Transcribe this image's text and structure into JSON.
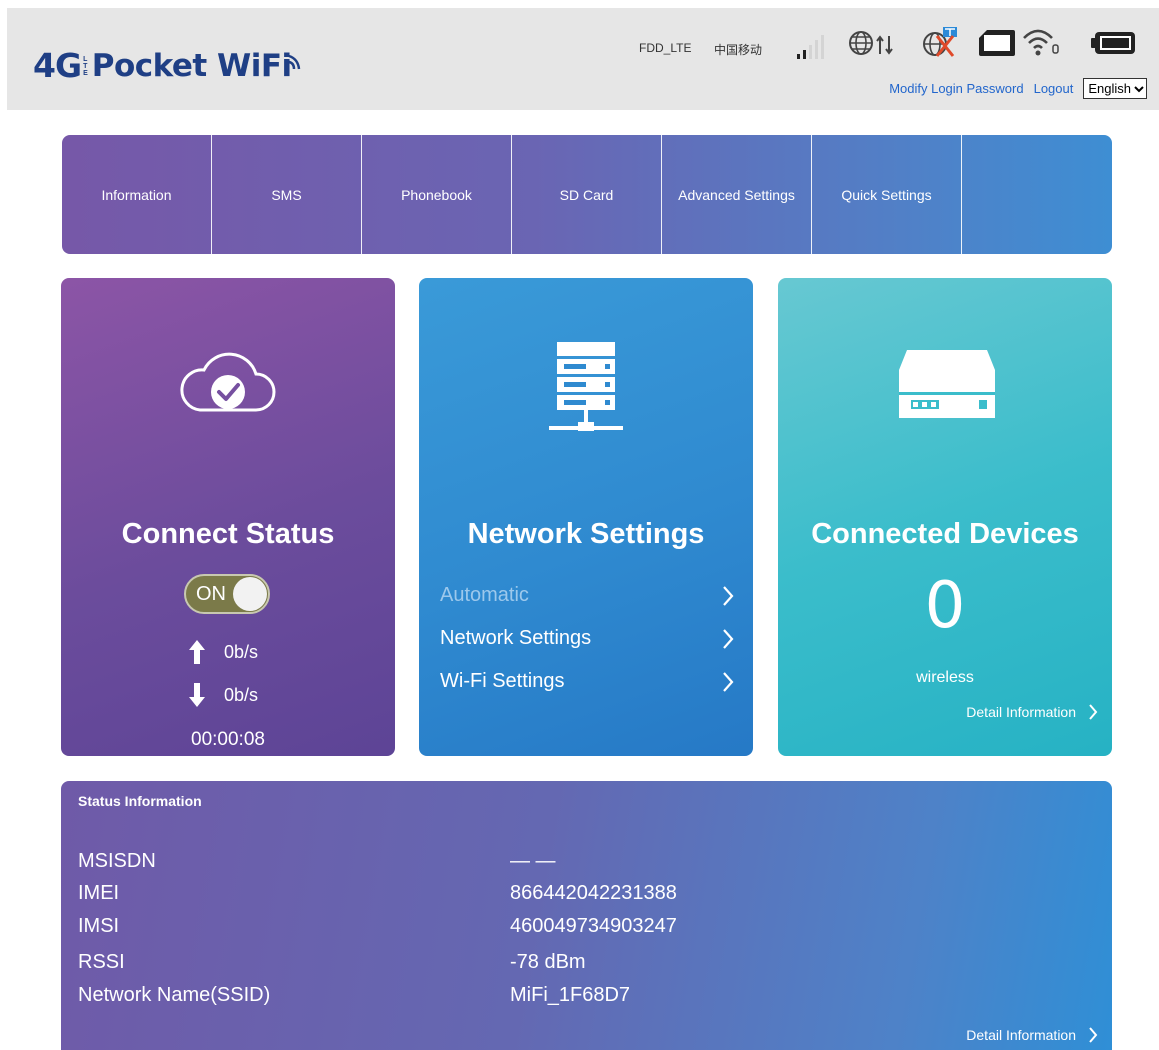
{
  "header": {
    "logo_4g": "4G",
    "logo_lte": [
      "L",
      "T",
      "E"
    ],
    "logo_text": "Pocket WiFi",
    "network_type": "FDD_LTE",
    "operator": "中国移动",
    "signal_level": 2,
    "signal_max": 5,
    "links": {
      "modify_password": "Modify Login Password",
      "logout": "Logout"
    },
    "language": "English"
  },
  "nav": {
    "items": [
      "Information",
      "SMS",
      "Phonebook",
      "SD Card",
      "Advanced Settings",
      "Quick Settings"
    ]
  },
  "connect_card": {
    "title": "Connect Status",
    "toggle_label": "ON",
    "upload_rate": "0b/s",
    "download_rate": "0b/s",
    "uptime": "00:00:08"
  },
  "network_card": {
    "title": "Network Settings",
    "items": [
      "Automatic",
      "Network Settings",
      "Wi-Fi Settings"
    ]
  },
  "devices_card": {
    "title": "Connected Devices",
    "count": "0",
    "type_label": "wireless",
    "detail_link": "Detail Information"
  },
  "status": {
    "title": "Status Information",
    "rows": [
      {
        "label": "MSISDN",
        "value": "— —"
      },
      {
        "label": "IMEI",
        "value": "866442042231388"
      },
      {
        "label": "IMSI",
        "value": "460049734903247"
      },
      {
        "label": "RSSI",
        "value": "-78 dBm"
      },
      {
        "label": "Network Name(SSID)",
        "value": "MiFi_1F68D7"
      }
    ],
    "detail_link": "Detail Information"
  },
  "colors": {
    "header_bg": "#e6e6e6",
    "logo": "#1f3f85",
    "link": "#2266cc",
    "connect_card": "#7650a0",
    "network_card": "#2f8ad0",
    "devices_card": "#3bbdcb",
    "toggle_on": "#7b7a49"
  }
}
